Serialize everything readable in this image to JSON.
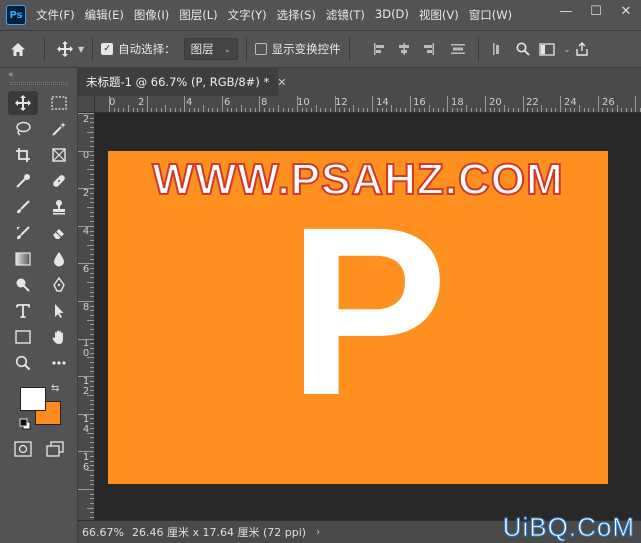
{
  "app": {
    "logo_text": "Ps"
  },
  "menu": [
    "文件(F)",
    "编辑(E)",
    "图像(I)",
    "图层(L)",
    "文字(Y)",
    "选择(S)",
    "滤镜(T)",
    "3D(D)",
    "视图(V)",
    "窗口(W)"
  ],
  "window_controls": {
    "minimize": "—",
    "maximize": "☐",
    "close": "✕"
  },
  "options": {
    "auto_select_label": "自动选择：",
    "auto_select_checked": true,
    "auto_select_target": "图层",
    "show_transform_label": "显示变换控件",
    "show_transform_checked": false
  },
  "toolbar": {
    "collapse": "«",
    "foreground_color": "#ffffff",
    "background_color": "#ff8c1a"
  },
  "document": {
    "tab_title": "未标题-1 @ 66.7% (P, RGB/8#) *",
    "tab_close": "✕",
    "canvas_color": "#ff8f1f",
    "canvas_url_text": "WWW.PSAHZ.COM",
    "canvas_letter": "P"
  },
  "rulers": {
    "horizontal": [
      "0",
      "2",
      "4",
      "6",
      "8",
      "10",
      "12",
      "14",
      "16",
      "18",
      "20",
      "22",
      "24",
      "26"
    ],
    "vertical": [
      "2",
      "0",
      "2",
      "4",
      "6",
      "8",
      "1\n0",
      "1\n2",
      "1\n4",
      "1\n6"
    ]
  },
  "status": {
    "zoom": "66.67%",
    "info": "26.46 厘米 x 17.64 厘米 (72 ppi)",
    "arrow": "›"
  },
  "watermark": "UiBQ.CoM"
}
